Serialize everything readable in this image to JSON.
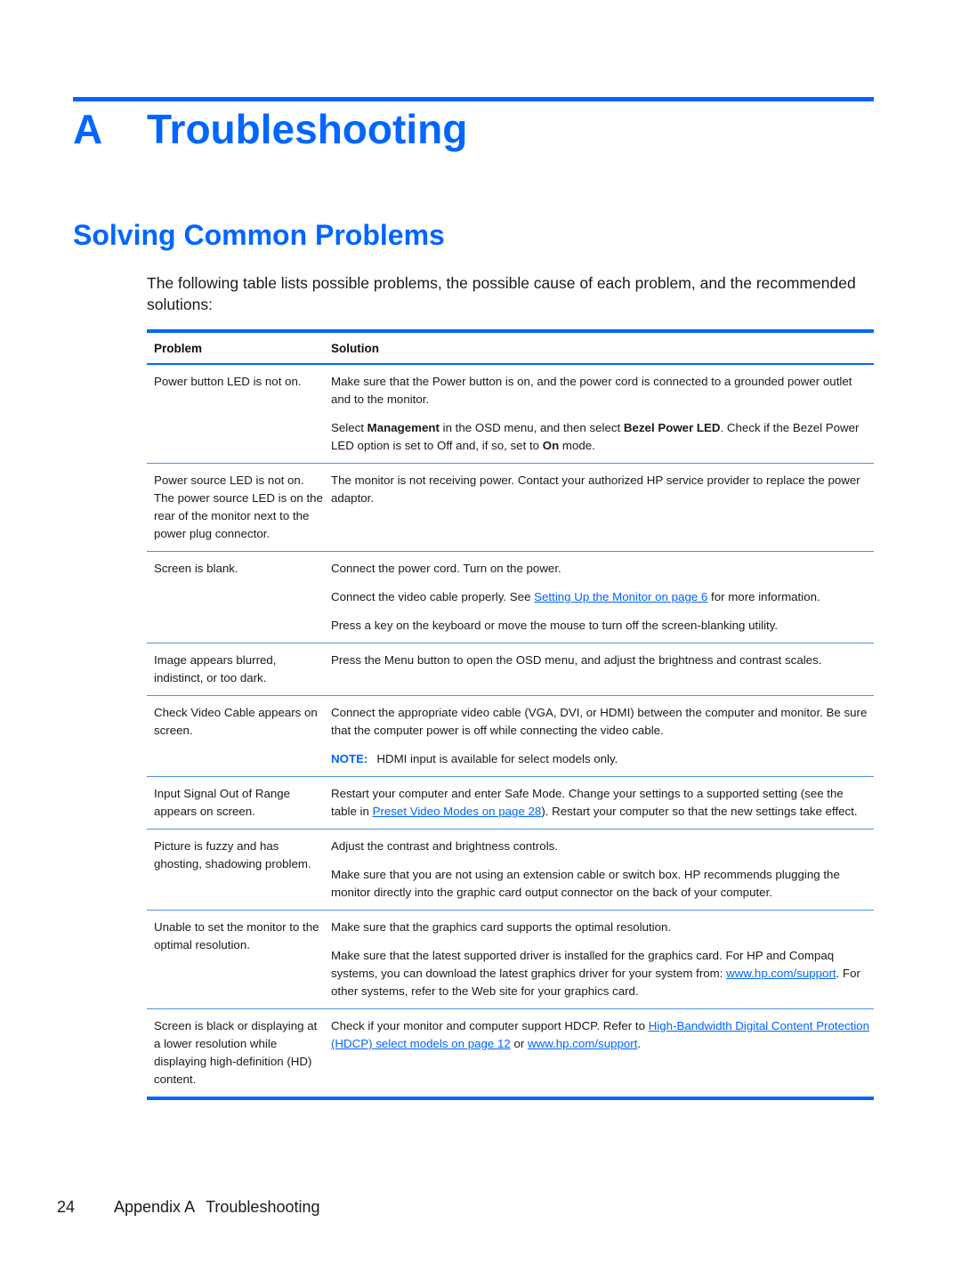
{
  "chapter": {
    "letter": "A",
    "title": "Troubleshooting"
  },
  "section": {
    "title": "Solving Common Problems"
  },
  "intro": "The following table lists possible problems, the possible cause of each problem, and the recommended solutions:",
  "table": {
    "headers": {
      "problem": "Problem",
      "solution": "Solution"
    },
    "rows": [
      {
        "problem": "Power button LED is not on.",
        "solutions": [
          {
            "text": "Make sure that the Power button is on, and the power cord is connected to a grounded power outlet and to the monitor."
          },
          {
            "parts": [
              "Select ",
              "Management",
              " in the OSD menu, and then select ",
              "Bezel Power LED",
              ". Check if the Bezel Power LED option is set to Off and, if so, set to ",
              "On",
              " mode."
            ]
          }
        ]
      },
      {
        "problem": "Power source LED is not on. The power source LED is on the rear of the monitor next to the power plug connector.",
        "solutions": [
          {
            "text": "The monitor is not receiving power. Contact your authorized HP service provider to replace the power adaptor."
          }
        ]
      },
      {
        "problem": "Screen is blank.",
        "solutions": [
          {
            "text": "Connect the power cord. Turn on the power."
          },
          {
            "before": "Connect the video cable properly. See ",
            "link": "Setting Up the Monitor on page 6",
            "after": " for more information."
          },
          {
            "text": "Press a key on the keyboard or move the mouse to turn off the screen-blanking utility."
          }
        ]
      },
      {
        "problem": "Image appears blurred, indistinct, or too dark.",
        "solutions": [
          {
            "text": "Press the Menu button to open the OSD menu, and adjust the brightness and contrast scales."
          }
        ]
      },
      {
        "problem": "Check Video Cable appears on screen.",
        "solutions": [
          {
            "text": "Connect the appropriate video cable (VGA, DVI, or HDMI) between the computer and monitor. Be sure that the computer power is off while connecting the video cable."
          },
          {
            "note_label": "NOTE:",
            "note_text": "HDMI input is available for select models only."
          }
        ]
      },
      {
        "problem": "Input Signal Out of Range appears on screen.",
        "solutions": [
          {
            "before": "Restart your computer and enter Safe Mode. Change your settings to a supported setting (see the table in ",
            "link": "Preset Video Modes on page 28",
            "after": "). Restart your computer so that the new settings take effect."
          }
        ]
      },
      {
        "problem": "Picture is fuzzy and has ghosting, shadowing problem.",
        "solutions": [
          {
            "text": "Adjust the contrast and brightness controls."
          },
          {
            "text": "Make sure that you are not using an extension cable or switch box. HP recommends plugging the monitor directly into the graphic card output connector on the back of your computer."
          }
        ]
      },
      {
        "problem": "Unable to set the monitor to the optimal resolution.",
        "solutions": [
          {
            "text": "Make sure that the graphics card supports the optimal resolution."
          },
          {
            "before": "Make sure that the latest supported driver is installed for the graphics card. For HP and Compaq systems, you can download the latest graphics driver for your system from: ",
            "link": "www.hp.com/support",
            "after": ". For other systems, refer to the Web site for your graphics card."
          }
        ]
      },
      {
        "problem": "Screen is black or displaying at a lower resolution while displaying high-definition (HD) content.",
        "solutions": [
          {
            "before": "Check if your monitor and computer support HDCP. Refer to ",
            "link": "High-Bandwidth Digital Content Protection (HDCP) select models on page 12",
            "middle": " or ",
            "link2": "www.hp.com/support",
            "after": "."
          }
        ]
      }
    ]
  },
  "footer": {
    "page_number": "24",
    "appendix": "Appendix A",
    "title": "Troubleshooting"
  },
  "colors": {
    "accent": "#0066ff",
    "text": "#1a1a1a",
    "row_divider": "#4a90e2"
  }
}
